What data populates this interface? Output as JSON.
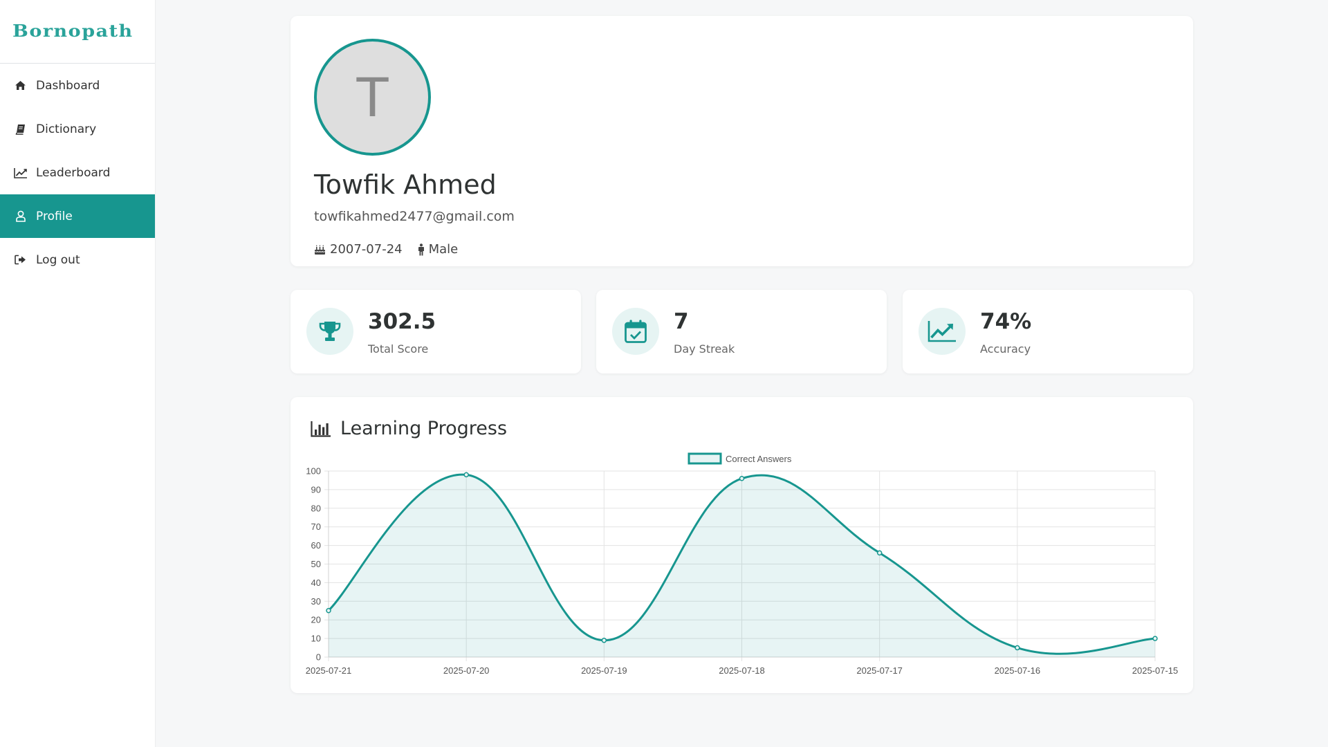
{
  "brand": {
    "name": "Bornopath"
  },
  "sidebar": {
    "items": [
      {
        "label": "Dashboard",
        "icon": "home-icon",
        "active": false
      },
      {
        "label": "Dictionary",
        "icon": "book-icon",
        "active": false
      },
      {
        "label": "Leaderboard",
        "icon": "line-chart-icon",
        "active": false
      },
      {
        "label": "Profile",
        "icon": "user-icon",
        "active": true
      },
      {
        "label": "Log out",
        "icon": "logout-icon",
        "active": false
      }
    ]
  },
  "profile": {
    "avatar_initial": "T",
    "name": "Towfik Ahmed",
    "email": "towfikahmed2477@gmail.com",
    "birthdate": "2007-07-24",
    "gender": "Male"
  },
  "stats": [
    {
      "value": "302.5",
      "label": "Total Score",
      "icon": "trophy-icon"
    },
    {
      "value": "7",
      "label": "Day Streak",
      "icon": "calendar-check-icon"
    },
    {
      "value": "74%",
      "label": "Accuracy",
      "icon": "trend-up-icon"
    }
  ],
  "colors": {
    "accent": "#17968f",
    "accent_fill": "rgba(23,150,143,0.1)"
  },
  "chart": {
    "title": "Learning Progress"
  },
  "chart_data": {
    "type": "line",
    "x": [
      "2025-07-21",
      "2025-07-20",
      "2025-07-19",
      "2025-07-18",
      "2025-07-17",
      "2025-07-16",
      "2025-07-15"
    ],
    "series": [
      {
        "name": "Correct Answers",
        "values": [
          25,
          98,
          9,
          96,
          56,
          5,
          10
        ]
      }
    ],
    "ylim": [
      0,
      100
    ],
    "yticks": [
      0,
      10,
      20,
      30,
      40,
      50,
      60,
      70,
      80,
      90,
      100
    ],
    "fill": true,
    "grid": true,
    "legend": "top-center",
    "xlabel": "",
    "ylabel": ""
  }
}
